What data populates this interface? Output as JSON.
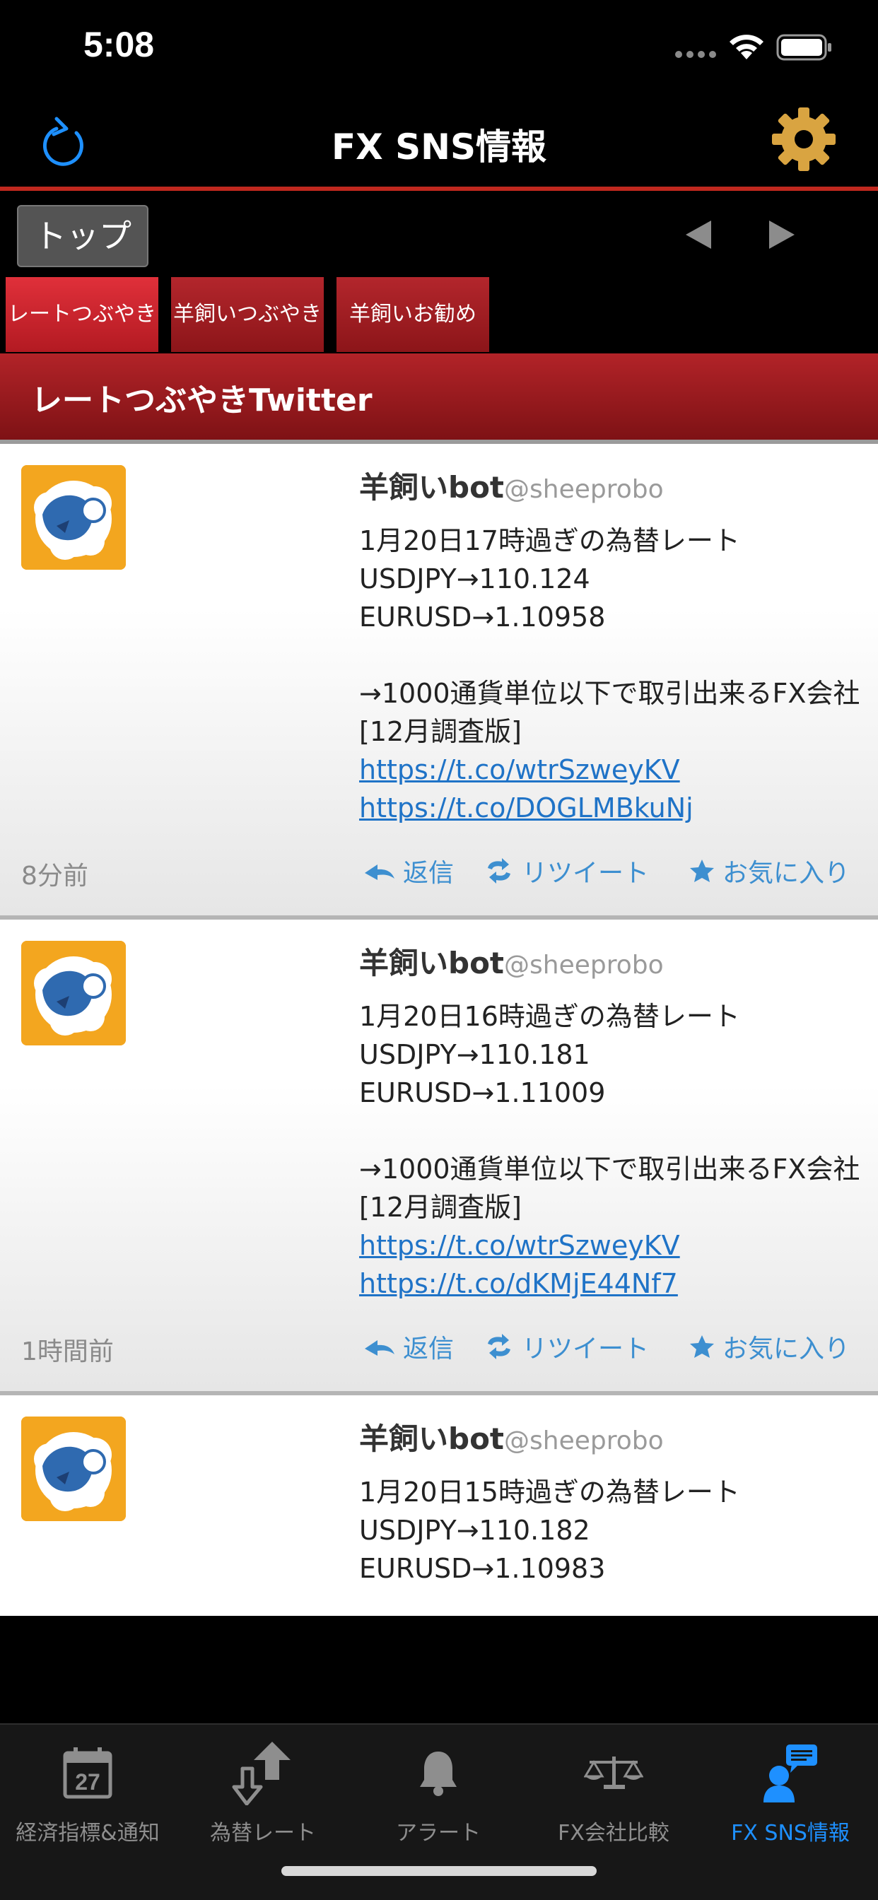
{
  "status_bar": {
    "time": "5:08"
  },
  "nav": {
    "title": "FX SNS情報"
  },
  "toolbar": {
    "top_button": "トップへ",
    "tabs": [
      {
        "label": "レートつぶやき",
        "active": true
      },
      {
        "label": "羊飼いつぶやき",
        "active": false
      },
      {
        "label": "羊飼いお勧め",
        "active": false
      }
    ]
  },
  "section": {
    "title": "レートつぶやきTwitter"
  },
  "tweets": [
    {
      "name": "羊飼いbot",
      "handle": "@sheeprobo",
      "lines": [
        "1月20日17時過ぎの為替レート",
        "USDJPY→110.124",
        "EURUSD→1.10958"
      ],
      "note": "→1000通貨単位以下で取引出来るFX会社[12月調査版]",
      "links": [
        "https://t.co/wtrSzweyKV",
        "https://t.co/DOGLMBkuNj"
      ],
      "time": "8分前",
      "actions": {
        "reply": "返信",
        "retweet": "リツイート",
        "favorite": "お気に入り"
      }
    },
    {
      "name": "羊飼いbot",
      "handle": "@sheeprobo",
      "lines": [
        "1月20日16時過ぎの為替レート",
        "USDJPY→110.181",
        "EURUSD→1.11009"
      ],
      "note": "→1000通貨単位以下で取引出来るFX会社[12月調査版]",
      "links": [
        "https://t.co/wtrSzweyKV",
        "https://t.co/dKMjE44Nf7"
      ],
      "time": "1時間前",
      "actions": {
        "reply": "返信",
        "retweet": "リツイート",
        "favorite": "お気に入り"
      }
    },
    {
      "name": "羊飼いbot",
      "handle": "@sheeprobo",
      "lines": [
        "1月20日15時過ぎの為替レート",
        "USDJPY→110.182",
        "EURUSD→1.10983"
      ]
    }
  ],
  "tab_bar": {
    "items": [
      {
        "label": "経済指標&通知",
        "icon": "calendar-icon",
        "calendar_day": "27",
        "active": false
      },
      {
        "label": "為替レート",
        "icon": "exchange-arrows-icon",
        "active": false
      },
      {
        "label": "アラート",
        "icon": "bell-icon",
        "active": false
      },
      {
        "label": "FX会社比較",
        "icon": "scale-icon",
        "active": false
      },
      {
        "label": "FX SNS情報",
        "icon": "user-chat-icon",
        "active": true
      }
    ]
  },
  "colors": {
    "accent_red": "#c0281e",
    "active_tab_blue": "#1e90ff",
    "link_blue": "#1f73c7",
    "action_blue": "#3d8fd0",
    "gear_gold": "#d9a441"
  }
}
